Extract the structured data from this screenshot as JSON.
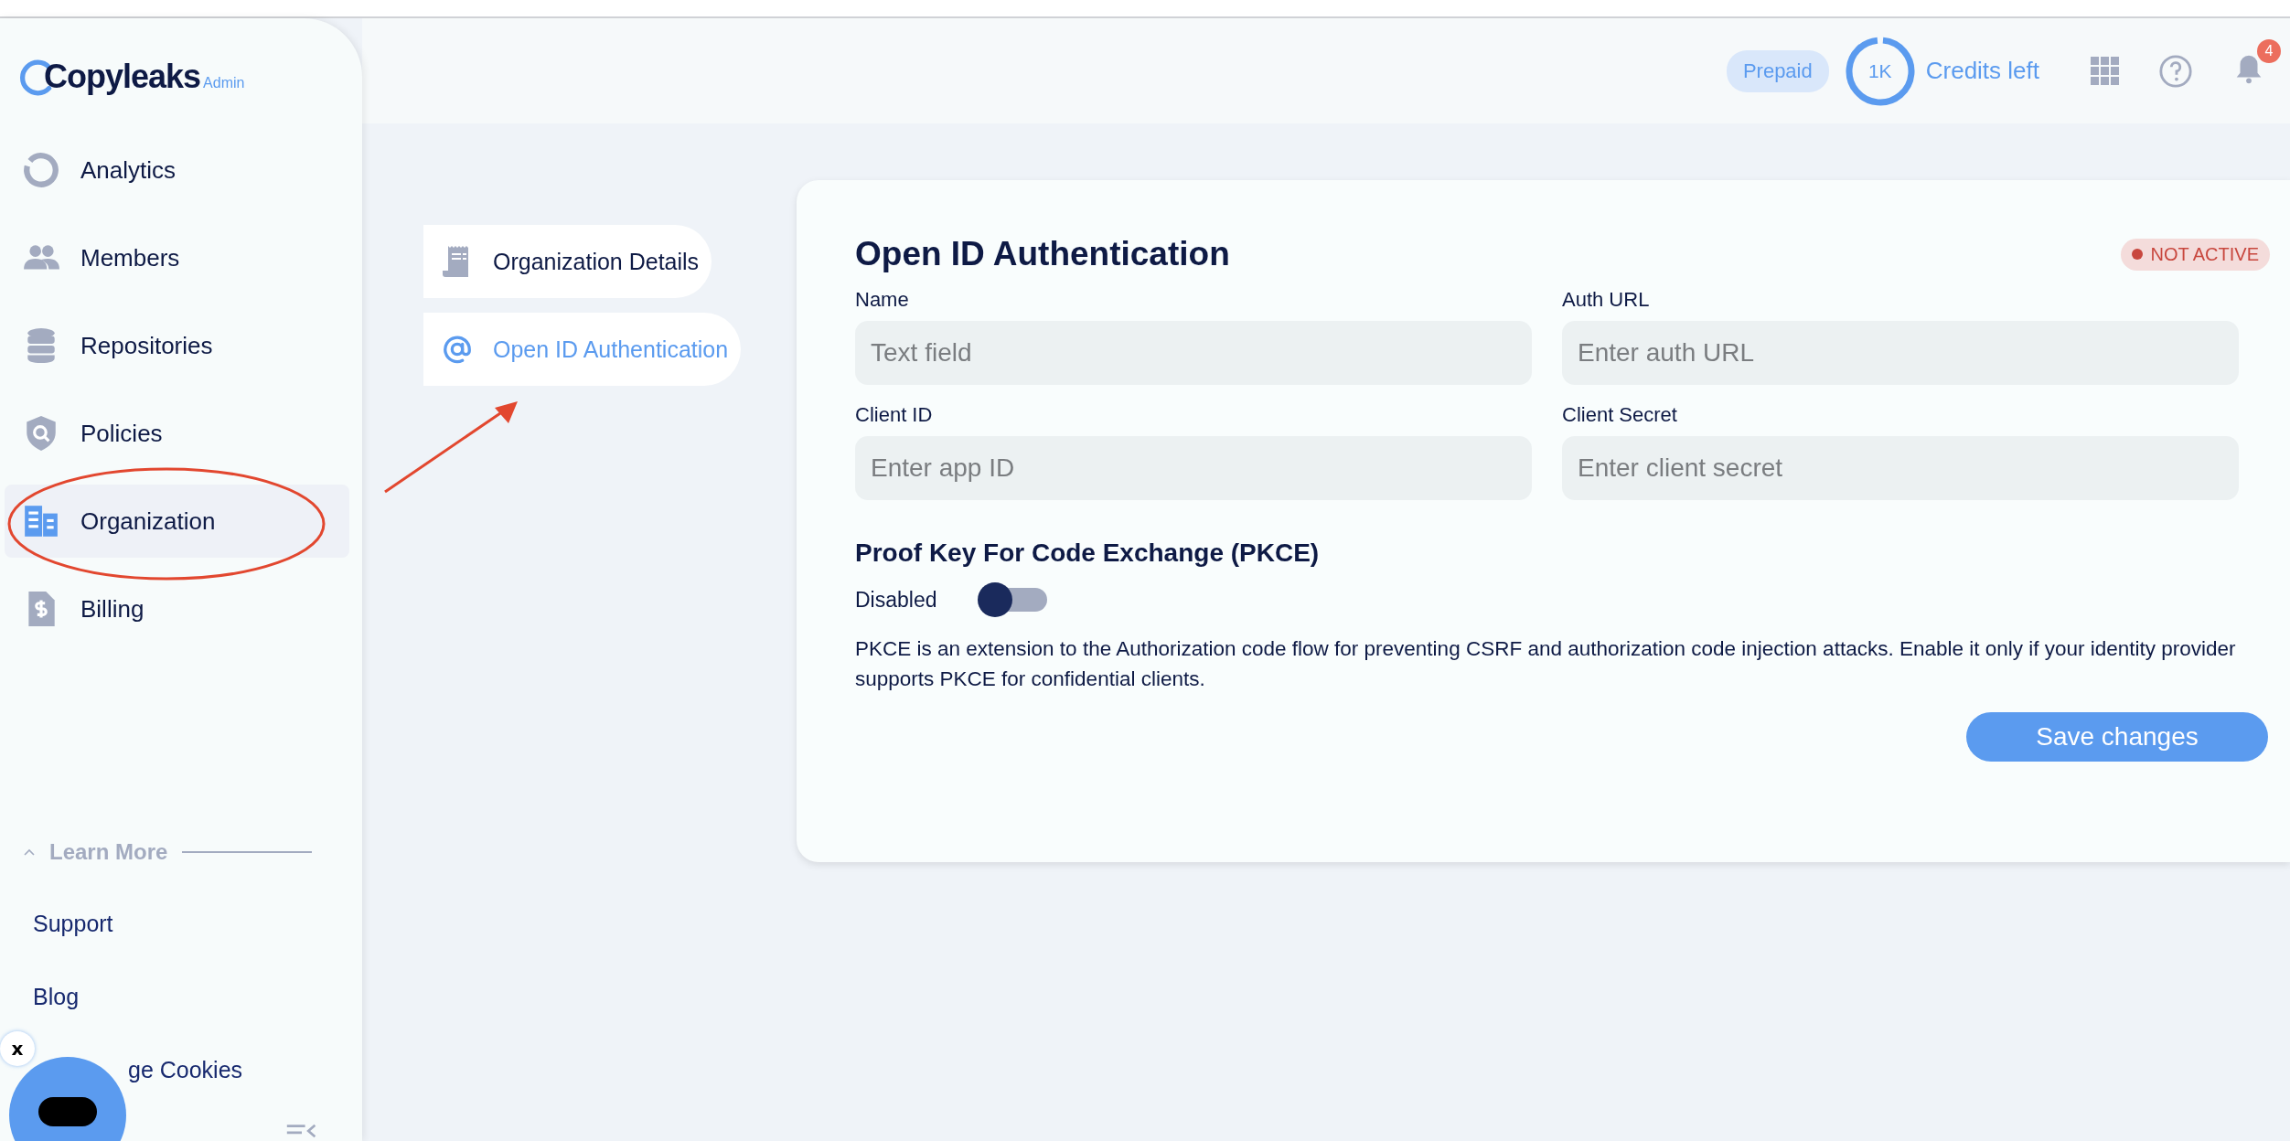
{
  "brand": {
    "name": "Copyleaks",
    "tag": "Admin"
  },
  "sidebar": {
    "items": [
      {
        "label": "Analytics",
        "selected": false
      },
      {
        "label": "Members",
        "selected": false
      },
      {
        "label": "Repositories",
        "selected": false
      },
      {
        "label": "Policies",
        "selected": false
      },
      {
        "label": "Organization",
        "selected": true
      },
      {
        "label": "Billing",
        "selected": false
      }
    ],
    "learn_more": {
      "label": "Learn More",
      "expanded": true,
      "links": [
        "Support",
        "Blog",
        "ge Cookies"
      ]
    }
  },
  "chat_widget": {
    "close": "x"
  },
  "header": {
    "plan": "Prepaid",
    "credits": {
      "amount": "1K",
      "label": "Credits left",
      "level": 0.97
    },
    "notifications": "4"
  },
  "subnav": {
    "items": [
      {
        "label": "Organization Details",
        "selected": false
      },
      {
        "label": "Open ID Authentication",
        "selected": true
      }
    ]
  },
  "card": {
    "title": "Open ID Authentication",
    "status": {
      "label": "NOT ACTIVE",
      "active": false
    },
    "fields": [
      {
        "label": "Name",
        "placeholder": "Text field"
      },
      {
        "label": "Auth URL",
        "placeholder": "Enter auth URL"
      },
      {
        "label": "Client ID",
        "placeholder": "Enter app ID"
      },
      {
        "label": "Client Secret",
        "placeholder": "Enter client secret"
      }
    ],
    "pkce": {
      "title": "Proof Key For Code Exchange (PKCE)",
      "state_label": "Disabled",
      "on": false,
      "description": "PKCE is an extension to the Authorization code flow for preventing CSRF and authorization code injection attacks. Enable it only if your identity provider supports PKCE for confidential clients."
    },
    "save_button": "Save changes"
  }
}
